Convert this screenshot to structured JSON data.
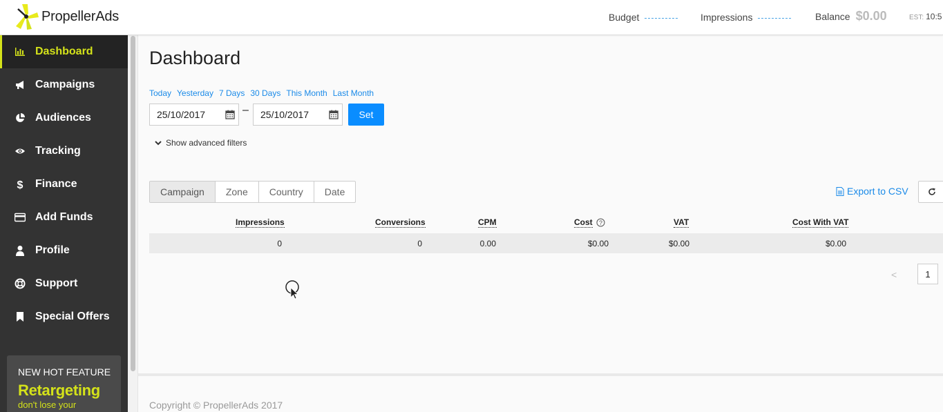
{
  "brand": {
    "name": "PropellerAds",
    "accent": "#d4e21a",
    "link": "#1a8ae8",
    "button": "#0a8dff"
  },
  "header": {
    "budget_label": "Budget",
    "impressions_label": "Impressions",
    "balance_label": "Balance",
    "balance_value": "$0.00",
    "est_label": "EST:",
    "time": "10:5"
  },
  "sidebar": {
    "items": [
      {
        "label": "Dashboard",
        "icon": "bar-chart-icon",
        "active": true
      },
      {
        "label": "Campaigns",
        "icon": "megaphone-icon"
      },
      {
        "label": "Audiences",
        "icon": "pie-chart-icon"
      },
      {
        "label": "Tracking",
        "icon": "eye-icon"
      },
      {
        "label": "Finance",
        "icon": "dollar-icon"
      },
      {
        "label": "Add Funds",
        "icon": "credit-card-icon"
      },
      {
        "label": "Profile",
        "icon": "user-icon"
      },
      {
        "label": "Support",
        "icon": "lifebuoy-icon"
      },
      {
        "label": "Special Offers",
        "icon": "bookmark-icon"
      }
    ],
    "promo": {
      "kicker": "NEW HOT FEATURE",
      "title": "Retargeting",
      "subtitle": "don't lose your"
    }
  },
  "main": {
    "title": "Dashboard",
    "quick_dates": [
      "Today",
      "Yesterday",
      "7 Days",
      "30 Days",
      "This Month",
      "Last Month"
    ],
    "date_from": "25/10/2017",
    "date_to": "25/10/2017",
    "date_separator": "–",
    "set_label": "Set",
    "advanced_filters_label": "Show advanced filters",
    "tabs": [
      "Campaign",
      "Zone",
      "Country",
      "Date"
    ],
    "export_label": "Export to CSV",
    "table": {
      "columns": [
        "Impressions",
        "Conversions",
        "CPM",
        "Cost",
        "VAT",
        "Cost With VAT"
      ],
      "row": [
        "0",
        "0",
        "0.00",
        "$0.00",
        "$0.00",
        "$0.00"
      ]
    },
    "pager": {
      "prev": "<",
      "page": "1"
    }
  },
  "footer": {
    "copyright": "Copyright © PropellerAds 2017"
  }
}
